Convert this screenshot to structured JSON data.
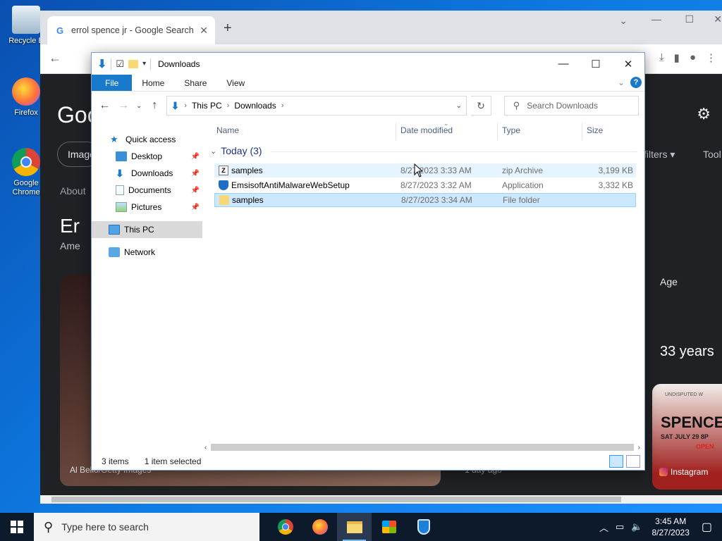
{
  "desktop": {
    "icons": [
      {
        "label": "Recycle B"
      },
      {
        "label": "Firefox"
      },
      {
        "label": "Google Chrome"
      }
    ]
  },
  "chrome": {
    "tab_title": "errol spence jr - Google Search",
    "page": {
      "logo_partial": "Goo",
      "images_chip": "Image",
      "about": "About",
      "heading_partial": "Er",
      "sub_partial": "Ame",
      "filters": "filters ▾",
      "tools_partial": "Tool",
      "age_label": "Age",
      "age_value": "33 years",
      "credit": "Al Bello/Getty Images",
      "time_ago": "1 day ago",
      "instagram": "Instagram",
      "promo_line1": "UNDISPUTED W",
      "promo_line2": "SPENCE",
      "promo_line3": "SAT JULY 29 8P",
      "promo_line4": "OPEN"
    }
  },
  "explorer": {
    "title": "Downloads",
    "ribbon_tabs": [
      "File",
      "Home",
      "Share",
      "View"
    ],
    "breadcrumb": [
      "This PC",
      "Downloads"
    ],
    "search_placeholder": "Search Downloads",
    "nav": {
      "quick_access": "Quick access",
      "desktop": "Desktop",
      "downloads": "Downloads",
      "documents": "Documents",
      "pictures": "Pictures",
      "this_pc": "This PC",
      "network": "Network"
    },
    "columns": {
      "name": "Name",
      "date": "Date modified",
      "type": "Type",
      "size": "Size"
    },
    "group_label": "Today (3)",
    "files": [
      {
        "name": "samples",
        "date": "8/27/2023 3:33 AM",
        "type": "zip Archive",
        "size": "3,199 KB"
      },
      {
        "name": "EmsisoftAntiMalwareWebSetup",
        "date": "8/27/2023 3:32 AM",
        "type": "Application",
        "size": "3,332 KB"
      },
      {
        "name": "samples",
        "date": "8/27/2023 3:34 AM",
        "type": "File folder",
        "size": ""
      }
    ],
    "status": {
      "items": "3 items",
      "selected": "1 item selected"
    }
  },
  "taskbar": {
    "search_placeholder": "Type here to search",
    "time": "3:45 AM",
    "date": "8/27/2023"
  },
  "colors": {
    "accent": "#1979ca",
    "selection": "#cce8ff",
    "hover": "#e5f3ff",
    "group_text": "#1e3287"
  }
}
